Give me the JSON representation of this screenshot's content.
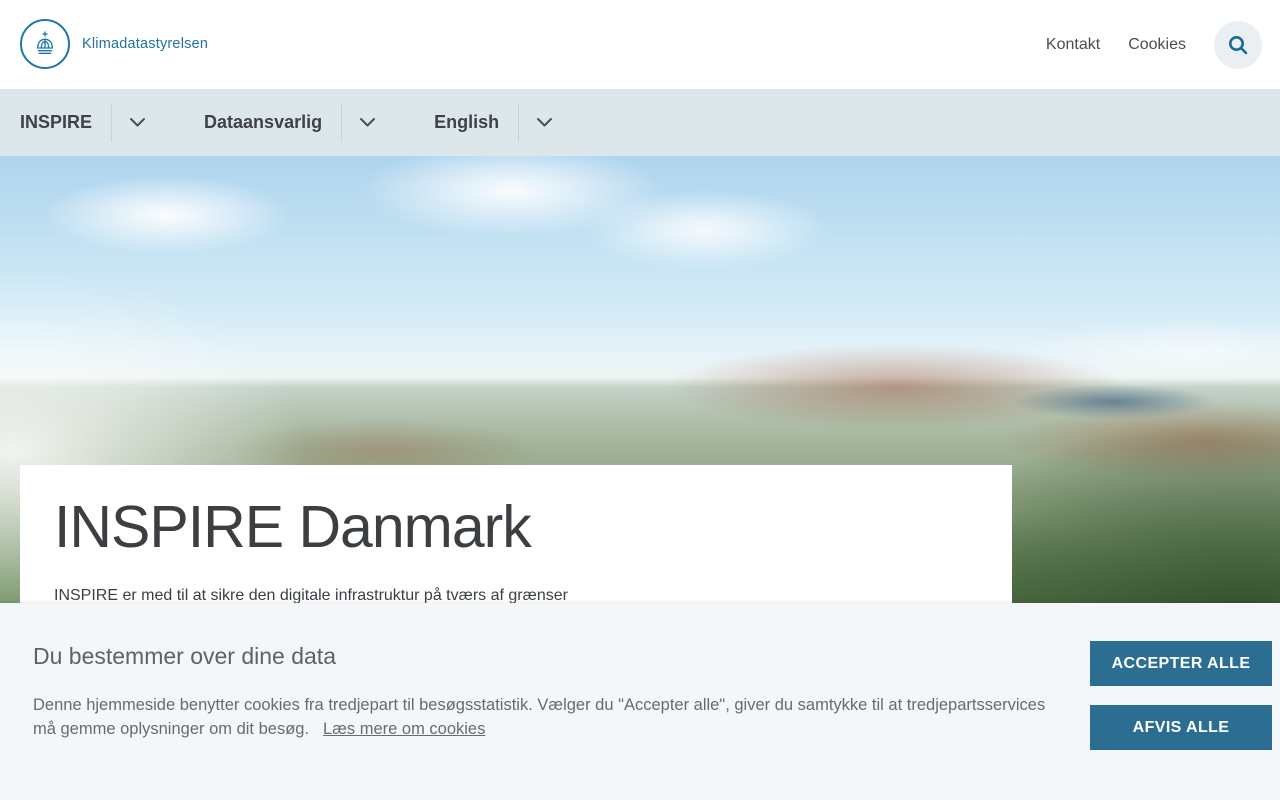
{
  "header": {
    "brand": "Klimadatastyrelsen",
    "links": [
      {
        "label": "Kontakt"
      },
      {
        "label": "Cookies"
      }
    ],
    "search_icon": "magnifier-icon",
    "logo_icon": "crown-in-circle"
  },
  "nav": {
    "items": [
      {
        "label": "INSPIRE"
      },
      {
        "label": "Dataansvarlig"
      },
      {
        "label": "English"
      }
    ]
  },
  "hero": {
    "title": "INSPIRE Danmark",
    "subtitle": "INSPIRE er med til at sikre den digitale infrastruktur på tværs af grænser",
    "image_description": "aerial-photo-of-copenhagen"
  },
  "cookie_banner": {
    "heading": "Du bestemmer over dine data",
    "body": "Denne hjemmeside benytter cookies fra tredjepart til besøgsstatistik. Vælger du \"Accepter alle\", giver du samtykke til at tredjepartsservices må gemme oplysninger om dit besøg.",
    "link": "Læs mere om cookies",
    "accept_label": "ACCEPTER ALLE",
    "reject_label": "AFVIS ALLE"
  },
  "colors": {
    "brand_blue": "#2176a8",
    "nav_bg": "#dce7ec",
    "button_bg": "#2b6e91",
    "banner_bg": "#f4f7fa",
    "text_dark": "#3c3f41",
    "text_gray": "#686b6e"
  }
}
